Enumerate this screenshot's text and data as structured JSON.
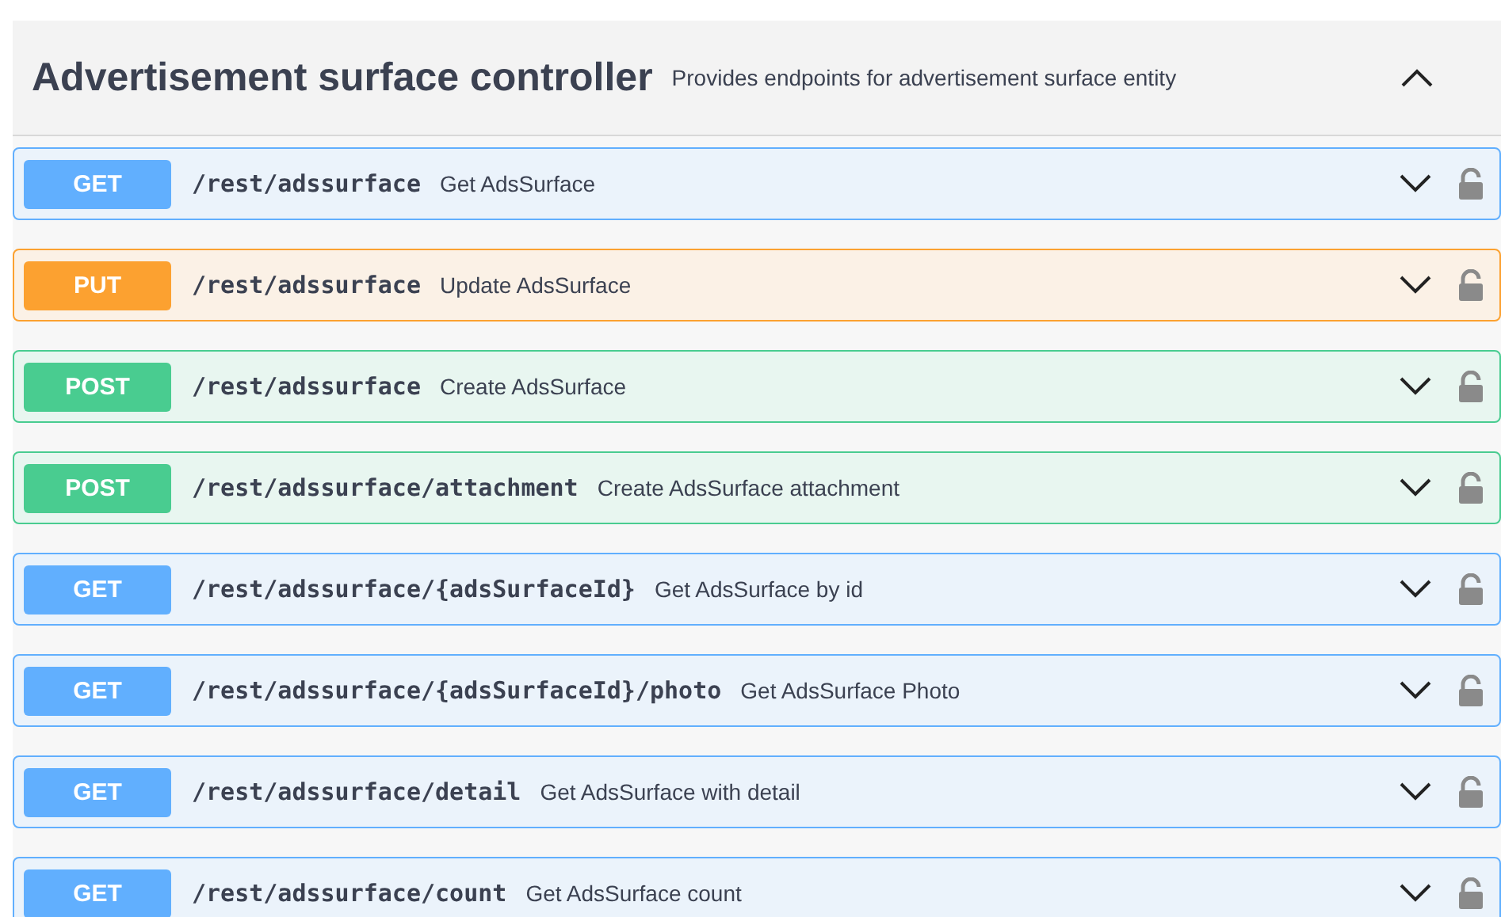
{
  "section": {
    "title": "Advertisement surface controller",
    "description": "Provides endpoints for advertisement surface entity",
    "expanded": true
  },
  "operations": [
    {
      "kind": "get",
      "method": "GET",
      "path": "/rest/adssurface",
      "summary": "Get AdsSurface",
      "expanded": false,
      "locked": false
    },
    {
      "kind": "put",
      "method": "PUT",
      "path": "/rest/adssurface",
      "summary": "Update AdsSurface",
      "expanded": false,
      "locked": false
    },
    {
      "kind": "post",
      "method": "POST",
      "path": "/rest/adssurface",
      "summary": "Create AdsSurface",
      "expanded": false,
      "locked": false
    },
    {
      "kind": "post",
      "method": "POST",
      "path": "/rest/adssurface/attachment",
      "summary": "Create AdsSurface attachment",
      "expanded": false,
      "locked": false
    },
    {
      "kind": "get",
      "method": "GET",
      "path": "/rest/adssurface/{adsSurfaceId}",
      "summary": "Get AdsSurface by id",
      "expanded": false,
      "locked": false
    },
    {
      "kind": "get",
      "method": "GET",
      "path": "/rest/adssurface/{adsSurfaceId}/photo",
      "summary": "Get AdsSurface Photo",
      "expanded": false,
      "locked": false
    },
    {
      "kind": "get",
      "method": "GET",
      "path": "/rest/adssurface/detail",
      "summary": "Get AdsSurface with detail",
      "expanded": false,
      "locked": false
    },
    {
      "kind": "get",
      "method": "GET",
      "path": "/rest/adssurface/count",
      "summary": "Get AdsSurface count",
      "expanded": false,
      "locked": false
    }
  ]
}
